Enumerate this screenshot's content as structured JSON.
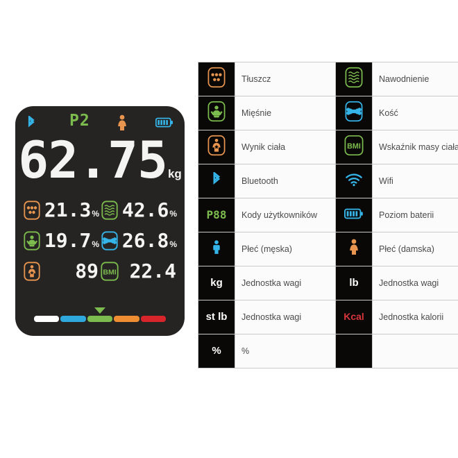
{
  "scale": {
    "status": {
      "bluetooth_icon": "bluetooth-icon",
      "user_code": "P2",
      "gender_icon": "female-icon",
      "battery_icon": "battery-full-icon"
    },
    "weight": {
      "value": "62.75",
      "unit": "kg"
    },
    "metrics": [
      {
        "icon": "body-fat-icon",
        "value": "21.3",
        "suffix": "%"
      },
      {
        "icon": "hydration-icon",
        "value": "42.6",
        "suffix": "%"
      },
      {
        "icon": "muscle-icon",
        "value": "19.7",
        "suffix": "%"
      },
      {
        "icon": "bone-icon",
        "value": "26.8",
        "suffix": "%"
      },
      {
        "icon": "body-score-icon",
        "value": "89",
        "suffix": ""
      },
      {
        "icon": "bmi-icon",
        "value": "22.4",
        "suffix": ""
      }
    ],
    "rating_bar": {
      "segments": [
        "#ffffff",
        "#2fa8dd",
        "#7cbb4d",
        "#ef8d33",
        "#d8252b"
      ],
      "pointer_segment_index": 2,
      "pointer_color": "#7cbb4d"
    }
  },
  "legend": {
    "rows": [
      {
        "left": {
          "icon": "body-fat-icon",
          "label": "Tłuszcz"
        },
        "right": {
          "icon": "hydration-icon",
          "label": "Nawodnienie"
        }
      },
      {
        "left": {
          "icon": "muscle-icon",
          "label": "Mięśnie"
        },
        "right": {
          "icon": "bone-icon",
          "label": "Kość"
        }
      },
      {
        "left": {
          "icon": "body-score-icon",
          "label": "Wynik ciała"
        },
        "right": {
          "icon": "bmi-icon",
          "label": "Wskaźnik masy ciała"
        }
      },
      {
        "left": {
          "icon": "bluetooth-icon",
          "label": "Bluetooth"
        },
        "right": {
          "icon": "wifi-icon",
          "label": "Wifi"
        }
      },
      {
        "left": {
          "icon": "user-code-icon",
          "icon_text": "P88",
          "label": "Kody użytkowników"
        },
        "right": {
          "icon": "battery-icon",
          "label": "Poziom baterii"
        }
      },
      {
        "left": {
          "icon": "male-icon",
          "label": "Płeć (męska)"
        },
        "right": {
          "icon": "female-icon",
          "label": "Płeć (damska)"
        }
      },
      {
        "left": {
          "icon": "unit-kg-icon",
          "icon_text": "kg",
          "label": "Jednostka wagi"
        },
        "right": {
          "icon": "unit-lb-icon",
          "icon_text": "lb",
          "label": "Jednostka wagi"
        }
      },
      {
        "left": {
          "icon": "unit-stlb-icon",
          "icon_text": "st lb",
          "label": "Jednostka wagi"
        },
        "right": {
          "icon": "unit-kcal-icon",
          "icon_text": "Kcal",
          "label": "Jednostka kalorii"
        }
      },
      {
        "left": {
          "icon": "unit-percent-icon",
          "icon_text": "%",
          "label": "%"
        },
        "right": {
          "icon": "",
          "icon_text": "",
          "label": ""
        }
      }
    ]
  },
  "colors": {
    "orange": "#e8954f",
    "green": "#7cbb4d",
    "blue": "#35b4e8",
    "red": "#d8353a",
    "display_bg": "#262423",
    "segment_white": "#f4f4f2"
  }
}
